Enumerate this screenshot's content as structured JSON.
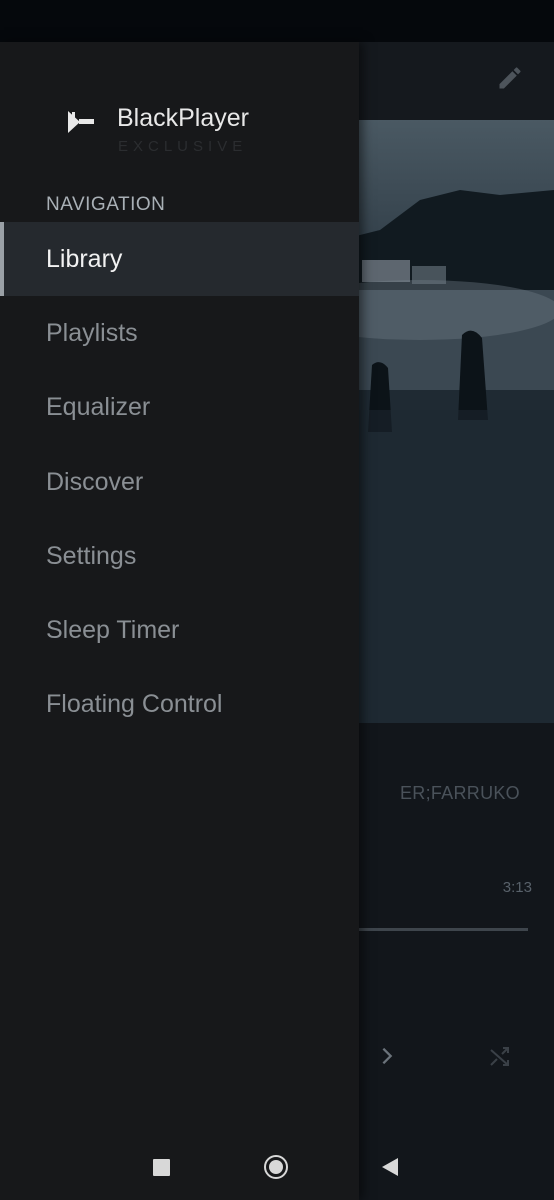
{
  "app": {
    "name": "BlackPlayer",
    "edition": "EXCLUSIVE"
  },
  "navigation": {
    "header": "NAVIGATION",
    "items": [
      {
        "label": "Library",
        "active": true
      },
      {
        "label": "Playlists",
        "active": false
      },
      {
        "label": "Equalizer",
        "active": false
      },
      {
        "label": "Discover",
        "active": false
      },
      {
        "label": "Settings",
        "active": false
      },
      {
        "label": "Sleep Timer",
        "active": false
      },
      {
        "label": "Floating Control",
        "active": false
      }
    ]
  },
  "now_playing": {
    "artist_partial": "ER;FARRUKO",
    "duration": "3:13"
  },
  "icons": {
    "edit": "edit-pencil-icon",
    "next": "next-chevron-icon",
    "shuffle": "shuffle-icon",
    "logo": "blackplayer-logo-icon"
  },
  "system_nav": {
    "recents": "recents-button",
    "home": "home-button",
    "back": "back-button"
  },
  "colors": {
    "drawer_bg": "#17181a",
    "active_item_bg": "#25292e",
    "accent_bar": "#9aa0a6"
  }
}
